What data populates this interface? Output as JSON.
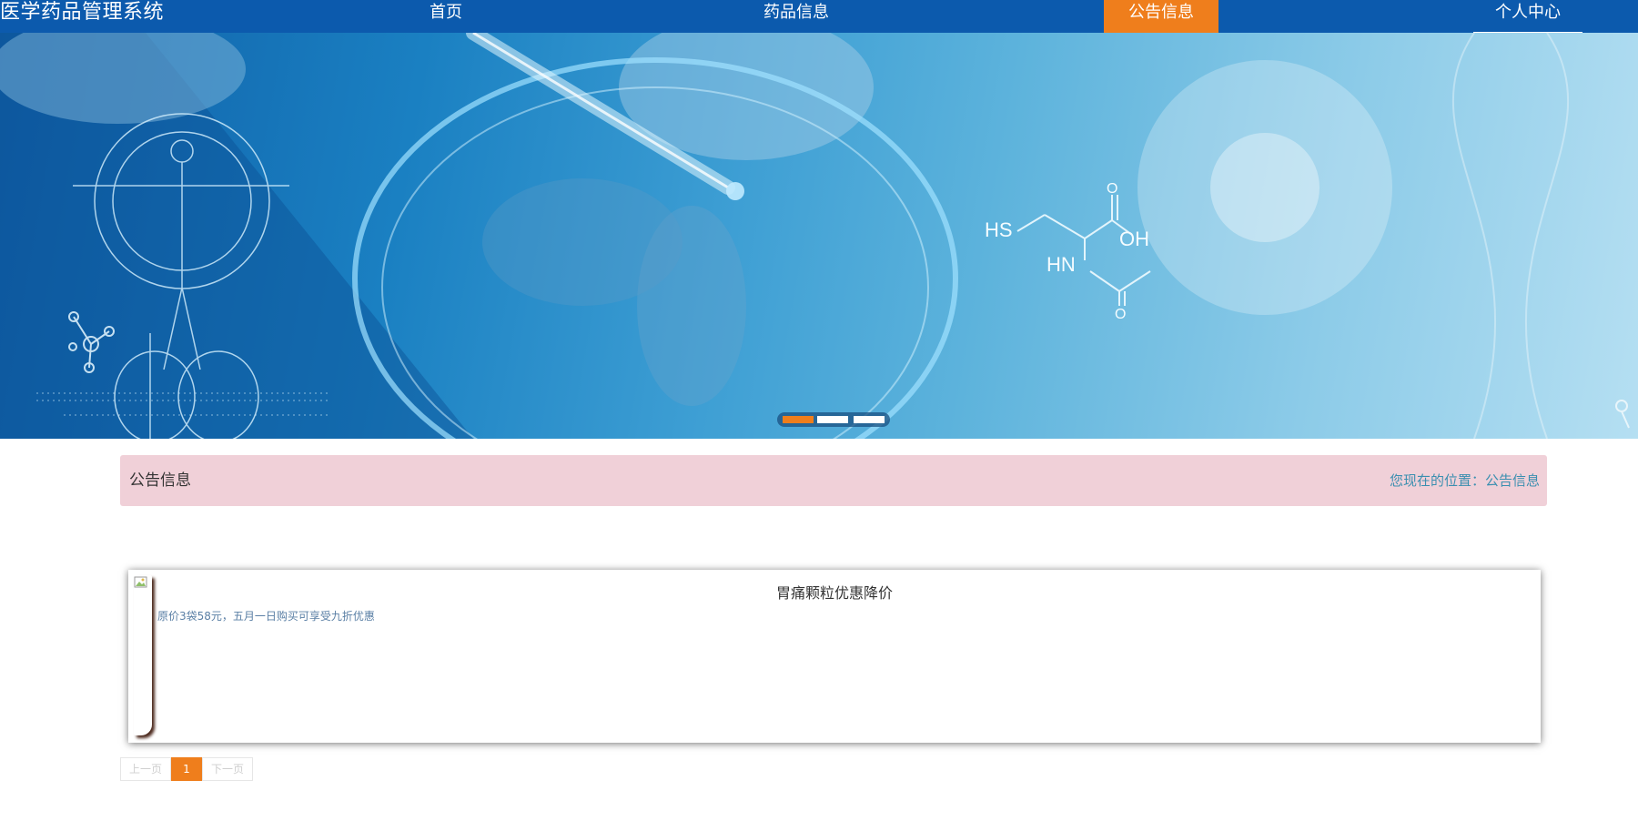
{
  "header": {
    "brand": "医学药品管理系统",
    "nav": [
      {
        "label": "首页",
        "active": false
      },
      {
        "label": "药品信息",
        "active": false
      },
      {
        "label": "公告信息",
        "active": true
      },
      {
        "label": "个人中心",
        "active": false
      }
    ],
    "accent_color": "#0c5aad",
    "active_color": "#ef7e1c"
  },
  "banner": {
    "image_text": {
      "hs": "HS",
      "hn": "HN",
      "oh": "OH",
      "o_top": "O",
      "o_bottom": "O"
    },
    "slides": 3,
    "active_slide": 1
  },
  "breadcrumb": {
    "title": "公告信息",
    "prefix": "您现在的位置：",
    "current": "公告信息"
  },
  "notices": [
    {
      "title": "胃痛颗粒优惠降价",
      "description": "原价3袋58元，五月一日购买可享受九折优惠",
      "image_icon": "broken-image-icon"
    }
  ],
  "pagination": {
    "prev": "上一页",
    "pages": [
      "1"
    ],
    "current": "1",
    "next": "下一页"
  }
}
